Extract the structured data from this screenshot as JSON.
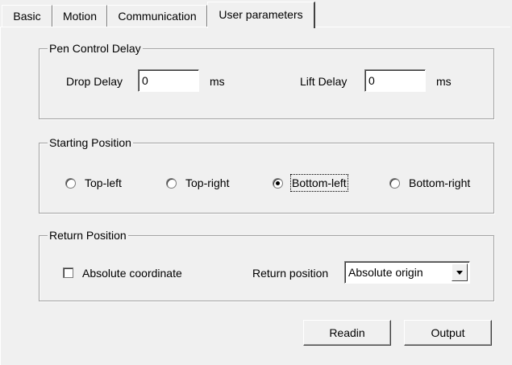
{
  "tabs": {
    "basic": "Basic",
    "motion": "Motion",
    "communication": "Communication",
    "user_parameters": "User parameters",
    "active": "User parameters"
  },
  "pen_control_delay": {
    "title": "Pen Control Delay",
    "drop_delay_label": "Drop Delay",
    "drop_delay_value": "0",
    "drop_delay_unit": "ms",
    "lift_delay_label": "Lift Delay",
    "lift_delay_value": "0",
    "lift_delay_unit": "ms"
  },
  "starting_position": {
    "title": "Starting Position",
    "options": [
      "Top-left",
      "Top-right",
      "Bottom-left",
      "Bottom-right"
    ],
    "selected": "Bottom-left"
  },
  "return_position": {
    "title": "Return Position",
    "absolute_coordinate_label": "Absolute coordinate",
    "absolute_coordinate_checked": false,
    "return_position_label": "Return position",
    "return_position_value": "Absolute origin"
  },
  "buttons": {
    "readin": "Readin",
    "output": "Output"
  },
  "colors": {
    "background": "#f0f0f0",
    "field": "#ffffff",
    "border": "#a0a0a0"
  }
}
